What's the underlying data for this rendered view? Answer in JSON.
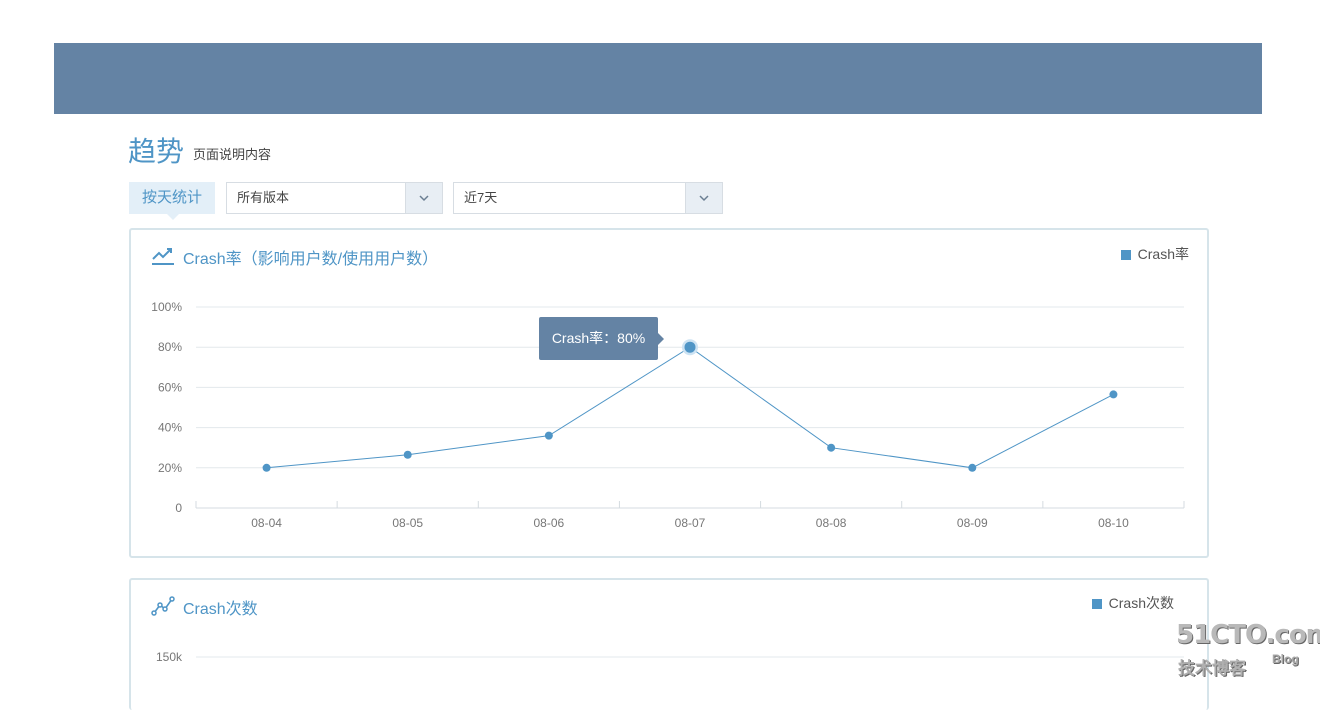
{
  "page": {
    "title": "趋势",
    "description": "页面说明内容"
  },
  "filters": {
    "stat_tab_label": "按天统计",
    "version_select_value": "所有版本",
    "range_select_value": "近7天"
  },
  "crash_rate_panel": {
    "title": "Crash率（影响用户数/使用用户数）",
    "legend": "Crash率",
    "tooltip": "Crash率：80%",
    "icon": "line-chart-icon"
  },
  "crash_count_panel": {
    "title": "Crash次数",
    "legend": "Crash次数",
    "icon": "line-chart-nodes-icon",
    "visible_y_tick": "150k"
  },
  "watermark": {
    "main": "51CTO.com",
    "sub": "技术博客",
    "blog": "Blog"
  },
  "colors": {
    "accent": "#4f95c6",
    "header": "#6483a4"
  },
  "chart_data": [
    {
      "type": "line",
      "title": "Crash率（影响用户数/使用用户数）",
      "categories": [
        "08-04",
        "08-05",
        "08-06",
        "08-07",
        "08-08",
        "08-09",
        "08-10"
      ],
      "series": [
        {
          "name": "Crash率",
          "values": [
            20,
            26.5,
            36,
            80,
            30,
            20,
            56.5
          ]
        }
      ],
      "y_ticks": [
        "0",
        "20%",
        "40%",
        "60%",
        "80%",
        "100%"
      ],
      "ylim": [
        0,
        100
      ],
      "unit": "%",
      "grid": true,
      "legend": "top-right",
      "highlight": {
        "category": "08-07",
        "label": "Crash率：80%"
      }
    },
    {
      "type": "line",
      "title": "Crash次数",
      "series": [
        {
          "name": "Crash次数",
          "values": []
        }
      ],
      "y_ticks": [
        "150k"
      ],
      "grid": true,
      "legend": "top-right"
    }
  ]
}
